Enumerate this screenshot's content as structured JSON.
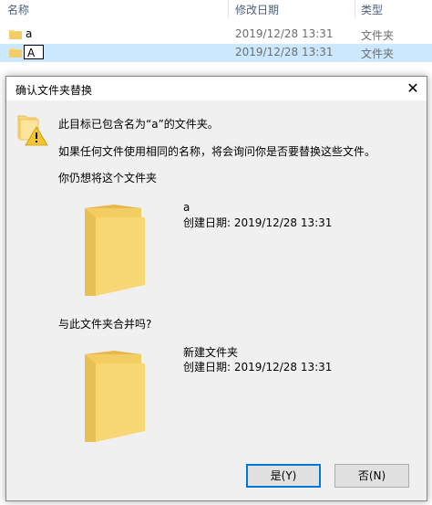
{
  "explorer": {
    "columns": {
      "name": "名称",
      "modified": "修改日期",
      "type": "类型"
    },
    "rows": [
      {
        "name": "a",
        "date": "2019/12/28 13:31",
        "type": "文件夹"
      },
      {
        "name": "A",
        "date": "2019/12/28 13:31",
        "type": "文件夹"
      }
    ]
  },
  "dialog": {
    "title": "确认文件夹替换",
    "close_glyph": "✕",
    "message1": "此目标已包含名为“a”的文件夹。",
    "message2": "如果任何文件使用相同的名称，将会询问你是否要替换这些文件。",
    "prompt1": "你仍想将这个文件夹",
    "target": {
      "name": "a",
      "created": "创建日期: 2019/12/28 13:31"
    },
    "prompt2": "与此文件夹合并吗?",
    "source": {
      "name": "新建文件夹",
      "created": "创建日期: 2019/12/28 13:31"
    },
    "yes_label": "是(Y)",
    "no_label": "否(N)"
  },
  "colors": {
    "folder": "#f8d775",
    "folder_dark": "#e6b84c",
    "accent": "#0078d7",
    "selection": "#cce8ff"
  }
}
